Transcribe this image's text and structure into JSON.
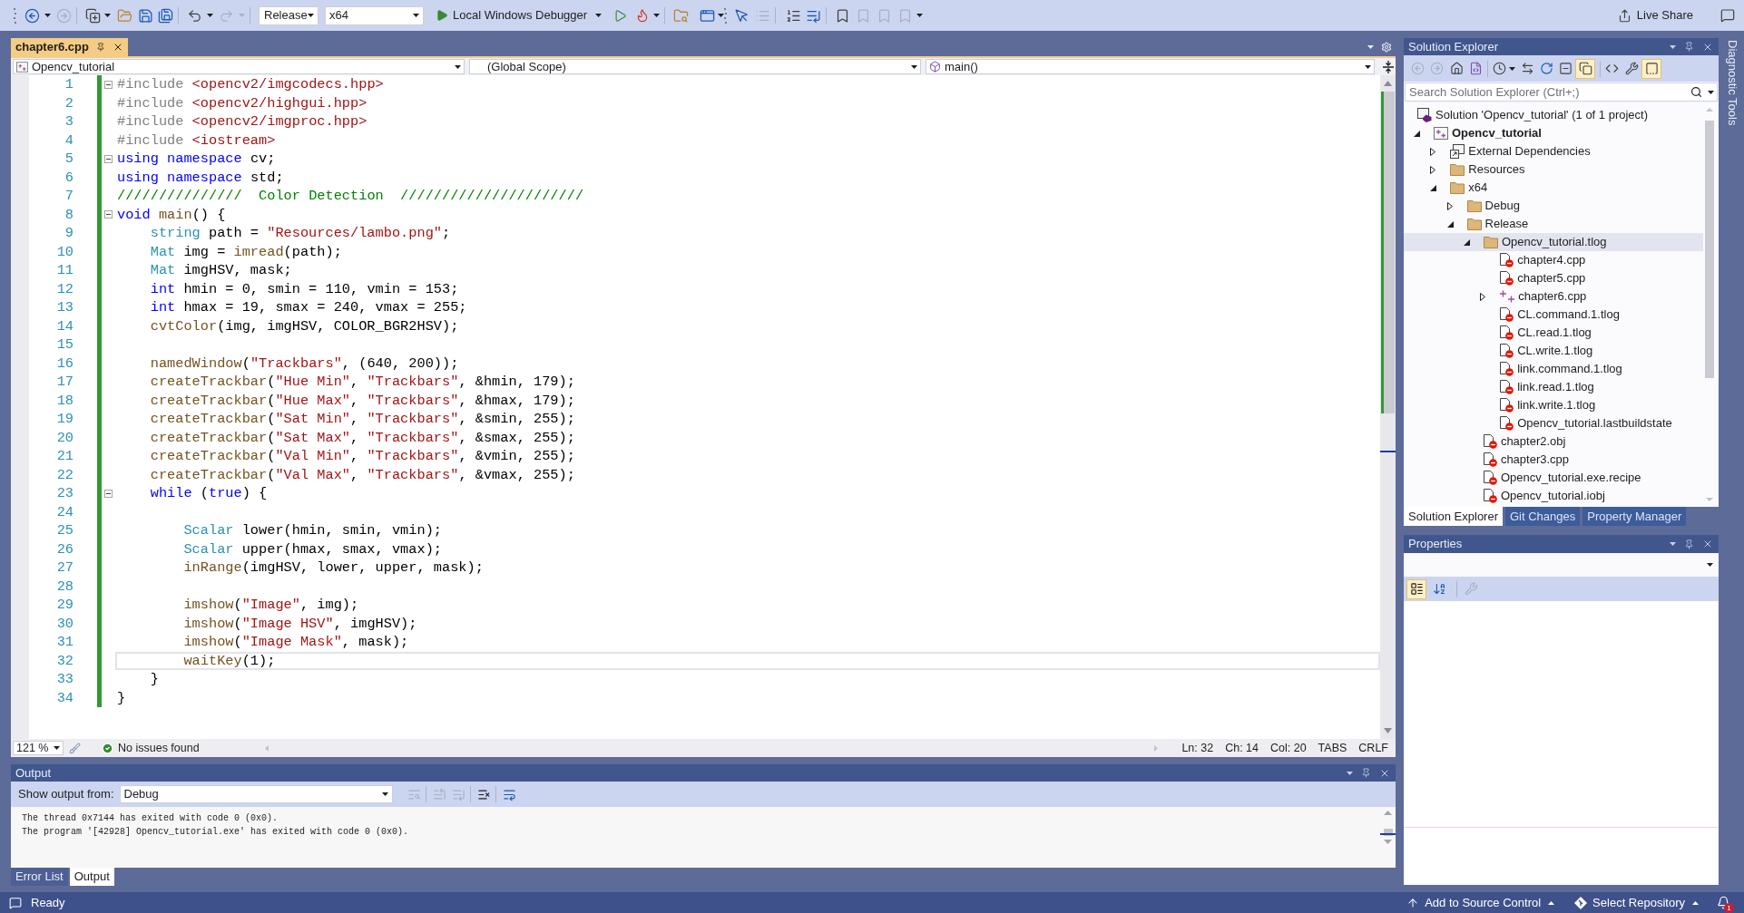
{
  "toolbar": {
    "configuration": "Release",
    "platform": "x64",
    "debugger": "Local Windows Debugger",
    "live_share": "Live Share"
  },
  "editor": {
    "tabs": [
      {
        "label": "chapter6.cpp",
        "selected": true
      }
    ],
    "nav": {
      "project": "Opencv_tutorial",
      "scope": "(Global Scope)",
      "member": "main()"
    },
    "changes_saved": true,
    "lines": [
      {
        "number": "1",
        "fold": true,
        "current": false,
        "tokens": [
          {
            "kind": "preproc",
            "text": "#include"
          },
          {
            "kind": "header",
            "text": " <opencv2/imgcodecs.hpp>"
          }
        ]
      },
      {
        "number": "2",
        "fold": false,
        "current": false,
        "tokens": [
          {
            "kind": "preproc",
            "text": "#include"
          },
          {
            "kind": "header",
            "text": " <opencv2/highgui.hpp>"
          }
        ]
      },
      {
        "number": "3",
        "fold": false,
        "current": false,
        "tokens": [
          {
            "kind": "preproc",
            "text": "#include"
          },
          {
            "kind": "header",
            "text": " <opencv2/imgproc.hpp>"
          }
        ]
      },
      {
        "number": "4",
        "fold": false,
        "current": false,
        "tokens": [
          {
            "kind": "preproc",
            "text": "#include"
          },
          {
            "kind": "header",
            "text": " <iostream>"
          }
        ]
      },
      {
        "number": "5",
        "fold": true,
        "current": false,
        "tokens": [
          {
            "kind": "keyword",
            "text": "using namespace"
          },
          {
            "kind": "plain",
            "text": " cv;"
          }
        ]
      },
      {
        "number": "6",
        "fold": false,
        "current": false,
        "tokens": [
          {
            "kind": "keyword",
            "text": "using namespace"
          },
          {
            "kind": "plain",
            "text": " std;"
          }
        ]
      },
      {
        "number": "7",
        "fold": false,
        "current": false,
        "tokens": [
          {
            "kind": "comment",
            "text": "///////////////  Color Detection  //////////////////////"
          }
        ]
      },
      {
        "number": "8",
        "fold": true,
        "current": false,
        "tokens": [
          {
            "kind": "keyword",
            "text": "void"
          },
          {
            "kind": "function",
            "text": " main"
          },
          {
            "kind": "plain",
            "text": "() {"
          }
        ],
        "children": [
          {
            "number": "9",
            "fold": false,
            "current": false,
            "tokens": [
              {
                "kind": "type",
                "text": "string"
              },
              {
                "kind": "plain",
                "text": " path = "
              },
              {
                "kind": "string",
                "text": "\"Resources/lambo.png\""
              },
              {
                "kind": "plain",
                "text": ";"
              }
            ]
          },
          {
            "number": "10",
            "fold": false,
            "current": false,
            "tokens": [
              {
                "kind": "type",
                "text": "Mat"
              },
              {
                "kind": "plain",
                "text": " img = "
              },
              {
                "kind": "function",
                "text": "imread"
              },
              {
                "kind": "plain",
                "text": "(path);"
              }
            ]
          },
          {
            "number": "11",
            "fold": false,
            "current": false,
            "tokens": [
              {
                "kind": "type",
                "text": "Mat"
              },
              {
                "kind": "plain",
                "text": " imgHSV, mask;"
              }
            ]
          },
          {
            "number": "12",
            "fold": false,
            "current": false,
            "tokens": [
              {
                "kind": "keyword",
                "text": "int"
              },
              {
                "kind": "plain",
                "text": " hmin = 0, smin = 110, vmin = 153;"
              }
            ]
          },
          {
            "number": "13",
            "fold": false,
            "current": false,
            "tokens": [
              {
                "kind": "keyword",
                "text": "int"
              },
              {
                "kind": "plain",
                "text": " hmax = 19, smax = 240, vmax = 255;"
              }
            ]
          },
          {
            "number": "14",
            "fold": false,
            "current": false,
            "tokens": [
              {
                "kind": "function",
                "text": "cvtColor"
              },
              {
                "kind": "plain",
                "text": "(img, imgHSV, COLOR_BGR2HSV);"
              }
            ]
          },
          {
            "number": "15",
            "fold": false,
            "current": false
          },
          {
            "number": "16",
            "fold": false,
            "current": false,
            "tokens": [
              {
                "kind": "function",
                "text": "namedWindow"
              },
              {
                "kind": "plain",
                "text": "("
              },
              {
                "kind": "string",
                "text": "\"Trackbars\""
              },
              {
                "kind": "plain",
                "text": ", (640, 200));"
              }
            ]
          },
          {
            "number": "17",
            "fold": false,
            "current": false,
            "tokens": [
              {
                "kind": "function",
                "text": "createTrackbar"
              },
              {
                "kind": "plain",
                "text": "("
              },
              {
                "kind": "string",
                "text": "\"Hue Min\""
              },
              {
                "kind": "plain",
                "text": ", "
              },
              {
                "kind": "string",
                "text": "\"Trackbars\""
              },
              {
                "kind": "plain",
                "text": ", &hmin, 179);"
              }
            ]
          },
          {
            "number": "18",
            "fold": false,
            "current": false,
            "tokens": [
              {
                "kind": "function",
                "text": "createTrackbar"
              },
              {
                "kind": "plain",
                "text": "("
              },
              {
                "kind": "string",
                "text": "\"Hue Max\""
              },
              {
                "kind": "plain",
                "text": ", "
              },
              {
                "kind": "string",
                "text": "\"Trackbars\""
              },
              {
                "kind": "plain",
                "text": ", &hmax, 179);"
              }
            ]
          },
          {
            "number": "19",
            "fold": false,
            "current": false,
            "tokens": [
              {
                "kind": "function",
                "text": "createTrackbar"
              },
              {
                "kind": "plain",
                "text": "("
              },
              {
                "kind": "string",
                "text": "\"Sat Min\""
              },
              {
                "kind": "plain",
                "text": ", "
              },
              {
                "kind": "string",
                "text": "\"Trackbars\""
              },
              {
                "kind": "plain",
                "text": ", &smin, 255);"
              }
            ]
          },
          {
            "number": "20",
            "fold": false,
            "current": false,
            "tokens": [
              {
                "kind": "function",
                "text": "createTrackbar"
              },
              {
                "kind": "plain",
                "text": "("
              },
              {
                "kind": "string",
                "text": "\"Sat Max\""
              },
              {
                "kind": "plain",
                "text": ", "
              },
              {
                "kind": "string",
                "text": "\"Trackbars\""
              },
              {
                "kind": "plain",
                "text": ", &smax, 255);"
              }
            ]
          },
          {
            "number": "21",
            "fold": false,
            "current": false,
            "tokens": [
              {
                "kind": "function",
                "text": "createTrackbar"
              },
              {
                "kind": "plain",
                "text": "("
              },
              {
                "kind": "string",
                "text": "\"Val Min\""
              },
              {
                "kind": "plain",
                "text": ", "
              },
              {
                "kind": "string",
                "text": "\"Trackbars\""
              },
              {
                "kind": "plain",
                "text": ", &vmin, 255);"
              }
            ]
          },
          {
            "number": "22",
            "fold": false,
            "current": false,
            "tokens": [
              {
                "kind": "function",
                "text": "createTrackbar"
              },
              {
                "kind": "plain",
                "text": "("
              },
              {
                "kind": "string",
                "text": "\"Val Max\""
              },
              {
                "kind": "plain",
                "text": ", "
              },
              {
                "kind": "string",
                "text": "\"Trackbars\""
              },
              {
                "kind": "plain",
                "text": ", &vmax, 255);"
              }
            ]
          },
          {
            "number": "23",
            "fold": true,
            "current": false,
            "tokens": [
              {
                "kind": "keyword",
                "text": "while"
              },
              {
                "kind": "plain",
                "text": " ("
              },
              {
                "kind": "keyword",
                "text": "true"
              },
              {
                "kind": "plain",
                "text": ") {"
              }
            ],
            "children": [
              {
                "number": "24",
                "fold": false,
                "current": false
              },
              {
                "number": "25",
                "fold": false,
                "current": false,
                "tokens": [
                  {
                    "kind": "type",
                    "text": "Scalar"
                  },
                  {
                    "kind": "plain",
                    "text": " lower(hmin, smin, vmin);"
                  }
                ]
              },
              {
                "number": "26",
                "fold": false,
                "current": false,
                "tokens": [
                  {
                    "kind": "type",
                    "text": "Scalar"
                  },
                  {
                    "kind": "plain",
                    "text": " upper(hmax, smax, vmax);"
                  }
                ]
              },
              {
                "number": "27",
                "fold": false,
                "current": false,
                "tokens": [
                  {
                    "kind": "function",
                    "text": "inRange"
                  },
                  {
                    "kind": "plain",
                    "text": "(imgHSV, lower, upper, mask);"
                  }
                ]
              },
              {
                "number": "28",
                "fold": false,
                "current": false
              },
              {
                "number": "29",
                "fold": false,
                "current": false,
                "tokens": [
                  {
                    "kind": "function",
                    "text": "imshow"
                  },
                  {
                    "kind": "plain",
                    "text": "("
                  },
                  {
                    "kind": "string",
                    "text": "\"Image\""
                  },
                  {
                    "kind": "plain",
                    "text": ", img);"
                  }
                ]
              },
              {
                "number": "30",
                "fold": false,
                "current": false,
                "tokens": [
                  {
                    "kind": "function",
                    "text": "imshow"
                  },
                  {
                    "kind": "plain",
                    "text": "("
                  },
                  {
                    "kind": "string",
                    "text": "\"Image HSV\""
                  },
                  {
                    "kind": "plain",
                    "text": ", imgHSV);"
                  }
                ]
              },
              {
                "number": "31",
                "fold": false,
                "current": false,
                "tokens": [
                  {
                    "kind": "function",
                    "text": "imshow"
                  },
                  {
                    "kind": "plain",
                    "text": "("
                  },
                  {
                    "kind": "string",
                    "text": "\"Image Mask\""
                  },
                  {
                    "kind": "plain",
                    "text": ", mask);"
                  }
                ]
              },
              {
                "number": "32",
                "fold": false,
                "current": true,
                "tokens": [
                  {
                    "kind": "function",
                    "text": "waitKey"
                  },
                  {
                    "kind": "plain",
                    "text": "(1);"
                  }
                ]
              }
            ]
          },
          {
            "number": "33",
            "fold": false,
            "current": false,
            "tokens": [
              {
                "kind": "plain",
                "text": "}"
              }
            ]
          }
        ]
      },
      {
        "number": "34",
        "fold": false,
        "current": false,
        "tokens": [
          {
            "kind": "plain",
            "text": "}"
          }
        ]
      }
    ],
    "status": {
      "zoom": "121 %",
      "issues": "No issues found",
      "line": "Ln: 32",
      "char": "Ch: 14",
      "column": "Col: 20",
      "indent_mode": "TABS",
      "line_ending": "CRLF"
    }
  },
  "output": {
    "title": "Output",
    "source_label": "Show output from:",
    "source": "Debug",
    "lines": [
      "The thread 0x7144 has exited with code 0 (0x0).",
      "The program '[42928] Opencv_tutorial.exe' has exited with code 0 (0x0)."
    ],
    "tabs": [
      {
        "label": "Error List",
        "selected": false
      },
      {
        "label": "Output",
        "selected": true
      }
    ]
  },
  "solution_explorer": {
    "title": "Solution Explorer",
    "show_all_files": true,
    "preview_selected": true,
    "search": {
      "placeholder": "Search Solution Explorer (Ctrl+;)"
    },
    "tree": [
      {
        "label": "Solution 'Opencv_tutorial' (1 of 1 project)",
        "kind": "solution",
        "selected": false,
        "children": [
          {
            "label": "Opencv_tutorial",
            "kind": "project",
            "expanded": true,
            "selected": false,
            "children": [
              {
                "label": "External Dependencies",
                "kind": "dependencies",
                "expanded": false,
                "selected": false
              },
              {
                "label": "Resources",
                "kind": "folder",
                "expanded": false,
                "selected": false
              },
              {
                "label": "x64",
                "kind": "folder",
                "expanded": true,
                "selected": false,
                "children": [
                  {
                    "label": "Debug",
                    "kind": "folder",
                    "expanded": false,
                    "selected": false
                  },
                  {
                    "label": "Release",
                    "kind": "folder",
                    "expanded": true,
                    "selected": false,
                    "children": [
                      {
                        "label": "Opencv_tutorial.tlog",
                        "kind": "folder",
                        "expanded": true,
                        "selected": true,
                        "children": [
                          {
                            "label": "chapter4.cpp",
                            "kind": "excluded-file",
                            "selected": false
                          },
                          {
                            "label": "chapter5.cpp",
                            "kind": "excluded-file",
                            "selected": false
                          },
                          {
                            "label": "chapter6.cpp",
                            "kind": "source-file",
                            "expanded": false,
                            "selected": false
                          },
                          {
                            "label": "CL.command.1.tlog",
                            "kind": "excluded-file",
                            "selected": false
                          },
                          {
                            "label": "CL.read.1.tlog",
                            "kind": "excluded-file",
                            "selected": false
                          },
                          {
                            "label": "CL.write.1.tlog",
                            "kind": "excluded-file",
                            "selected": false
                          },
                          {
                            "label": "link.command.1.tlog",
                            "kind": "excluded-file",
                            "selected": false
                          },
                          {
                            "label": "link.read.1.tlog",
                            "kind": "excluded-file",
                            "selected": false
                          },
                          {
                            "label": "link.write.1.tlog",
                            "kind": "excluded-file",
                            "selected": false
                          },
                          {
                            "label": "Opencv_tutorial.lastbuildstate",
                            "kind": "excluded-file",
                            "selected": false
                          }
                        ]
                      },
                      {
                        "label": "chapter2.obj",
                        "kind": "excluded-file",
                        "selected": false
                      },
                      {
                        "label": "chapter3.cpp",
                        "kind": "excluded-file",
                        "selected": false
                      },
                      {
                        "label": "Opencv_tutorial.exe.recipe",
                        "kind": "excluded-file",
                        "selected": false
                      },
                      {
                        "label": "Opencv_tutorial.iobj",
                        "kind": "excluded-file",
                        "selected": false
                      }
                    ]
                  }
                ]
              }
            ]
          }
        ]
      }
    ],
    "tabs": [
      {
        "label": "Solution Explorer",
        "selected": true
      },
      {
        "label": "Git Changes",
        "selected": false
      },
      {
        "label": "Property Manager",
        "selected": false
      }
    ]
  },
  "properties": {
    "title": "Properties",
    "categorized": true,
    "alphabetical": false
  },
  "diagnostic_tools": {
    "label": "Diagnostic Tools"
  },
  "status_bar": {
    "text": "Ready",
    "source_control": "Add to Source Control",
    "repository": "Select Repository",
    "notifications": "1"
  }
}
